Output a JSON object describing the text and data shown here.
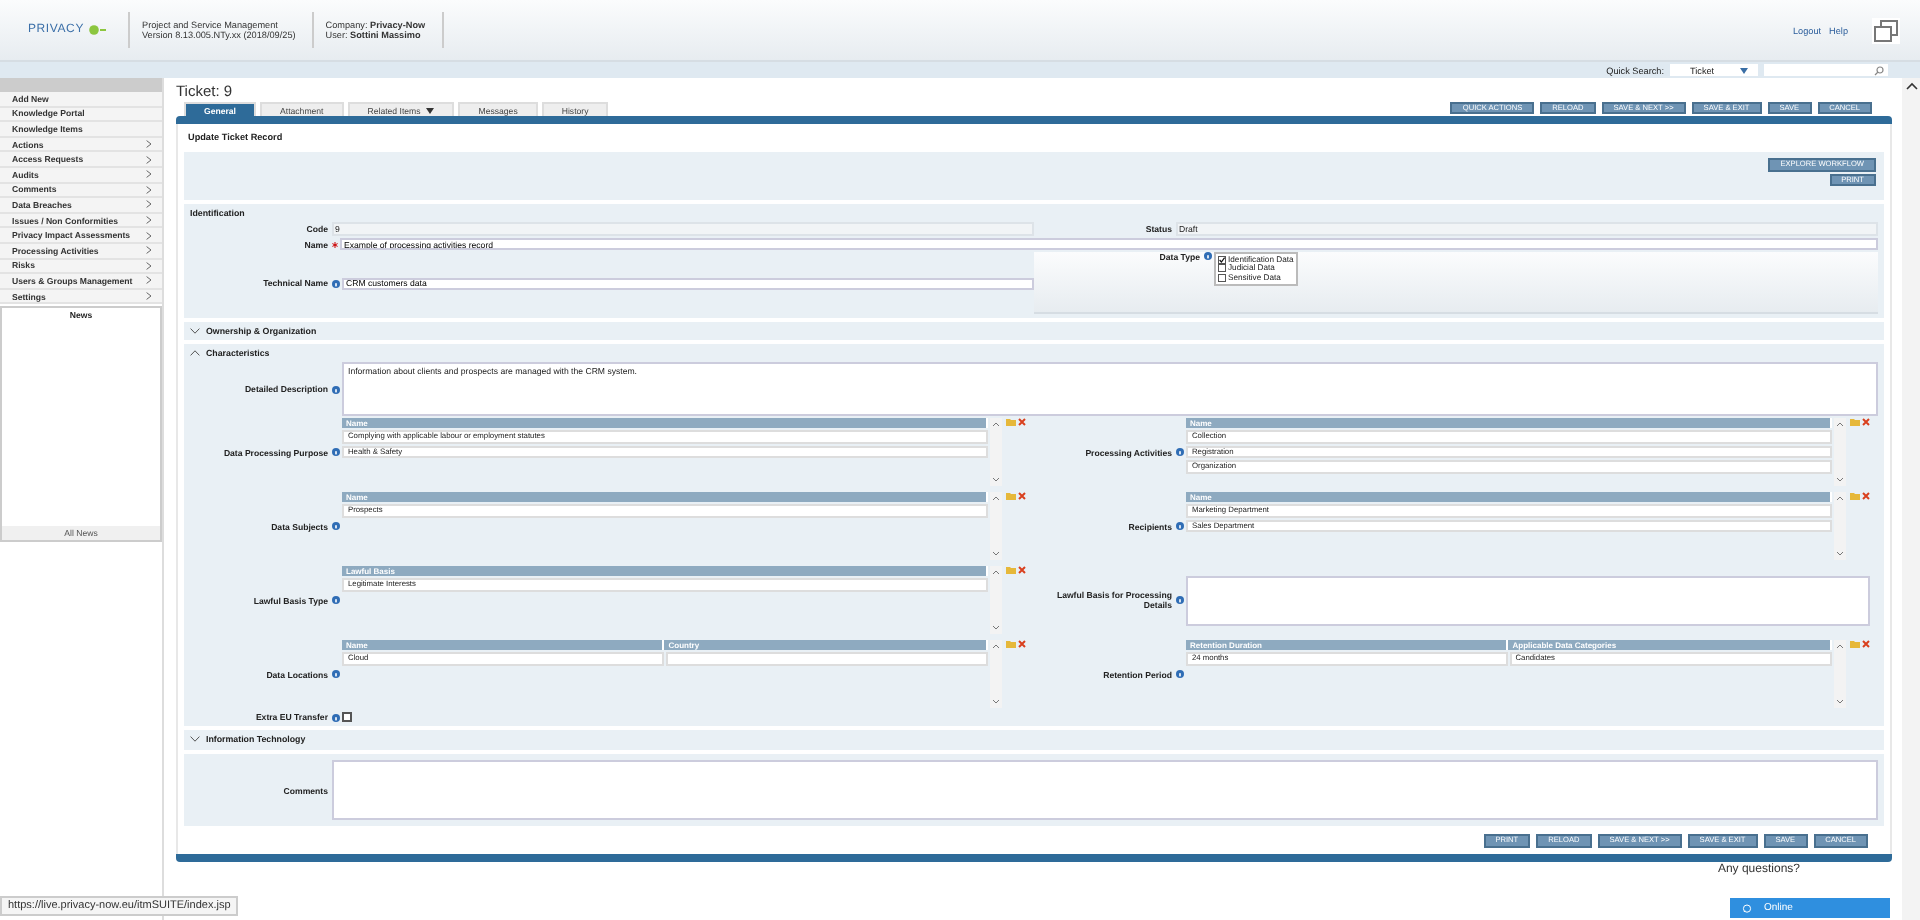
{
  "header": {
    "logo": "PRIVACY",
    "app_title": "Project and Service Management",
    "version": "Version 8.13.005.NTy.xx (2018/09/25)",
    "company": "Company: **Privacy-Now**",
    "user": "User: **Sottini Massimo**",
    "links": [
      "Logout",
      "Help"
    ]
  },
  "quick_search": {
    "label": "Quick Search:",
    "scope": "Ticket"
  },
  "sidebar": {
    "items": [
      {
        "label": "Add New",
        "submenu": false
      },
      {
        "label": "Knowledge Portal",
        "submenu": false
      },
      {
        "label": "Knowledge Items",
        "submenu": false
      },
      {
        "label": "Actions",
        "submenu": true
      },
      {
        "label": "Access Requests",
        "submenu": true
      },
      {
        "label": "Audits",
        "submenu": true
      },
      {
        "label": "Comments",
        "submenu": true
      },
      {
        "label": "Data Breaches",
        "submenu": true
      },
      {
        "label": "Issues / Non Conformities",
        "submenu": true
      },
      {
        "label": "Privacy Impact Assessments",
        "submenu": true
      },
      {
        "label": "Processing Activities",
        "submenu": true
      },
      {
        "label": "Risks",
        "submenu": true
      },
      {
        "label": "Users & Groups Management",
        "submenu": true
      },
      {
        "label": "Settings",
        "submenu": true
      }
    ],
    "news": {
      "title": "News",
      "footer": "All News"
    }
  },
  "ticket": {
    "title": "Ticket: 9",
    "tabs": [
      {
        "label": "General",
        "selected": true,
        "dropdown": false
      },
      {
        "label": "Attachment",
        "selected": false,
        "dropdown": false
      },
      {
        "label": "Related Items",
        "selected": false,
        "dropdown": true
      },
      {
        "label": "Messages",
        "selected": false,
        "dropdown": false
      },
      {
        "label": "History",
        "selected": false,
        "dropdown": false
      }
    ]
  },
  "top_buttons": [
    "QUICK ACTIONS",
    "RELOAD",
    "SAVE & NEXT >>",
    "SAVE & EXIT",
    "SAVE",
    "CANCEL"
  ],
  "form_title": "Update Ticket Record",
  "workflow_buttons": [
    "EXPLORE WORKFLOW",
    "PRINT"
  ],
  "identification": {
    "title": "Identification",
    "code": {
      "label": "Code",
      "value": "9"
    },
    "status": {
      "label": "Status",
      "value": "Draft"
    },
    "name": {
      "label": "Name",
      "required": true,
      "value": "Example of processing activities record"
    },
    "technical_name": {
      "label": "Technical Name",
      "value": "CRM customers data"
    },
    "data_type": {
      "label": "Data Type",
      "options": [
        {
          "label": "Identification Data",
          "checked": true
        },
        {
          "label": "Judicial Data",
          "checked": false
        },
        {
          "label": "Sensitive Data",
          "checked": false
        }
      ]
    }
  },
  "ownership": {
    "title": "Ownership & Organization",
    "expanded": false
  },
  "characteristics": {
    "title": "Characteristics",
    "expanded": true,
    "description": {
      "label": "Detailed Description",
      "value": "Information about clients and prospects are managed with the CRM system."
    },
    "fields": [
      {
        "label": "Data Processing Purpose",
        "kind": "grid",
        "columns": [
          "Name"
        ],
        "rows": [
          [
            "Complying with applicable labour or employment statutes"
          ],
          [
            "Health & Safety"
          ]
        ]
      },
      {
        "label": "Processing Activities",
        "kind": "grid",
        "columns": [
          "Name"
        ],
        "rows": [
          [
            "Collection"
          ],
          [
            "Registration"
          ],
          [
            "Organization"
          ]
        ]
      },
      {
        "label": "Data Subjects",
        "kind": "grid",
        "columns": [
          "Name"
        ],
        "rows": [
          [
            "Prospects"
          ]
        ]
      },
      {
        "label": "Recipients",
        "kind": "grid",
        "columns": [
          "Name"
        ],
        "rows": [
          [
            "Marketing Department"
          ],
          [
            "Sales Department"
          ]
        ]
      },
      {
        "label": "Lawful Basis Type",
        "kind": "grid",
        "columns": [
          "Lawful Basis"
        ],
        "rows": [
          [
            "Legitimate Interests"
          ]
        ]
      },
      {
        "label": "Lawful Basis for Processing Details",
        "kind": "textarea"
      },
      {
        "label": "Data Locations",
        "kind": "grid",
        "columns": [
          "Name",
          "Country"
        ],
        "rows": [
          [
            "Cloud"
          ]
        ]
      },
      {
        "label": "Retention Period",
        "kind": "grid",
        "columns": [
          "Retention Duration",
          "Applicable Data Categories"
        ],
        "rows": [
          [
            "24 months",
            "Candidates"
          ]
        ]
      }
    ],
    "extra_eu_transfer": {
      "label": "Extra EU Transfer",
      "checked": false
    }
  },
  "information_technology": {
    "title": "Information Technology",
    "expanded": false,
    "comments_label": "Comments"
  },
  "bottom_buttons": [
    "PRINT",
    "RELOAD",
    "SAVE & NEXT >>",
    "SAVE & EXIT",
    "SAVE",
    "CANCEL"
  ],
  "status_url": "https://live.privacy-now.eu/itmSUITE/index.jsp",
  "chat": {
    "bubble": "Any questions?",
    "status": "Online"
  }
}
